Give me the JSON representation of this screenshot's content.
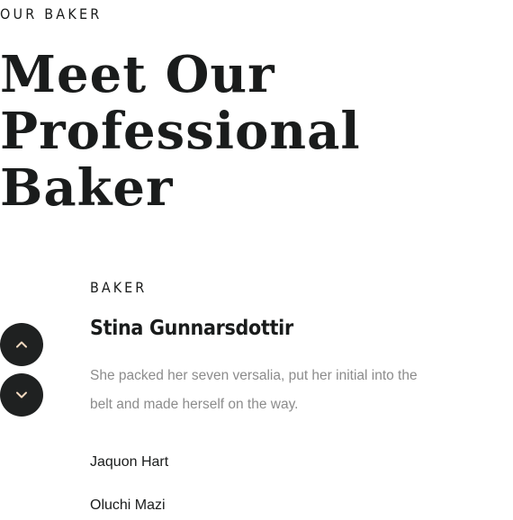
{
  "section": {
    "eyebrow": "OUR BAKER",
    "title": "Meet Our Professional Baker"
  },
  "active_baker": {
    "role": "BAKER",
    "name": "Stina Gunnarsdottir",
    "bio": "She packed her seven versalia, put her initial into the belt and made herself on the way."
  },
  "baker_list": [
    {
      "name": "Jaquon Hart"
    },
    {
      "name": "Oluchi Mazi"
    }
  ],
  "controls": {
    "up_icon": "chevron-up-icon",
    "down_icon": "chevron-down-icon",
    "button_color": "#1f2121",
    "icon_color": "#f3d9bf"
  }
}
